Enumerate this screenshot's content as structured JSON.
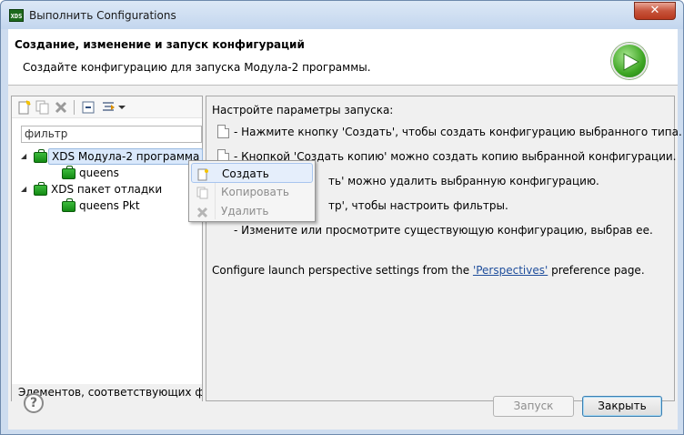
{
  "window": {
    "title": "Выполнить Configurations",
    "app_icon_text": "XDS",
    "close_symbol": "✕"
  },
  "banner": {
    "title": "Создание, изменение и запуск конфигураций",
    "description": "Создайте конфигурацию для запуска Модула-2 программы."
  },
  "left": {
    "filter_value": "фильтр",
    "tree": [
      {
        "label": "XDS Модула-2 программа",
        "children": [
          {
            "label": "queens"
          }
        ]
      },
      {
        "label": "XDS пакет отладки",
        "children": [
          {
            "label": "queens Pkt"
          }
        ]
      }
    ],
    "status": "Элементов, соответствующих фильтру"
  },
  "right": {
    "intro": "Настройте параметры запуска:",
    "lines": [
      "- Нажмите кнопку 'Создать', чтобы создать конфигурацию выбранного типа.",
      "- Кнопкой 'Создать копию' можно создать копию выбранной конфигурации.",
      "ть' можно удалить выбранную конфигурацию.",
      "тр', чтобы настроить фильтры.",
      "- Измените или просмотрите существующую конфигурацию, выбрав ее."
    ],
    "perspective_prefix": "Configure launch perspective settings from the ",
    "perspective_link": "'Perspectives'",
    "perspective_suffix": " preference page."
  },
  "context_menu": {
    "items": [
      {
        "label": "Создать",
        "enabled": true
      },
      {
        "label": "Копировать",
        "enabled": false
      },
      {
        "label": "Удалить",
        "enabled": false
      }
    ]
  },
  "buttons": {
    "help": "?",
    "run": "Запуск",
    "close": "Закрыть"
  }
}
